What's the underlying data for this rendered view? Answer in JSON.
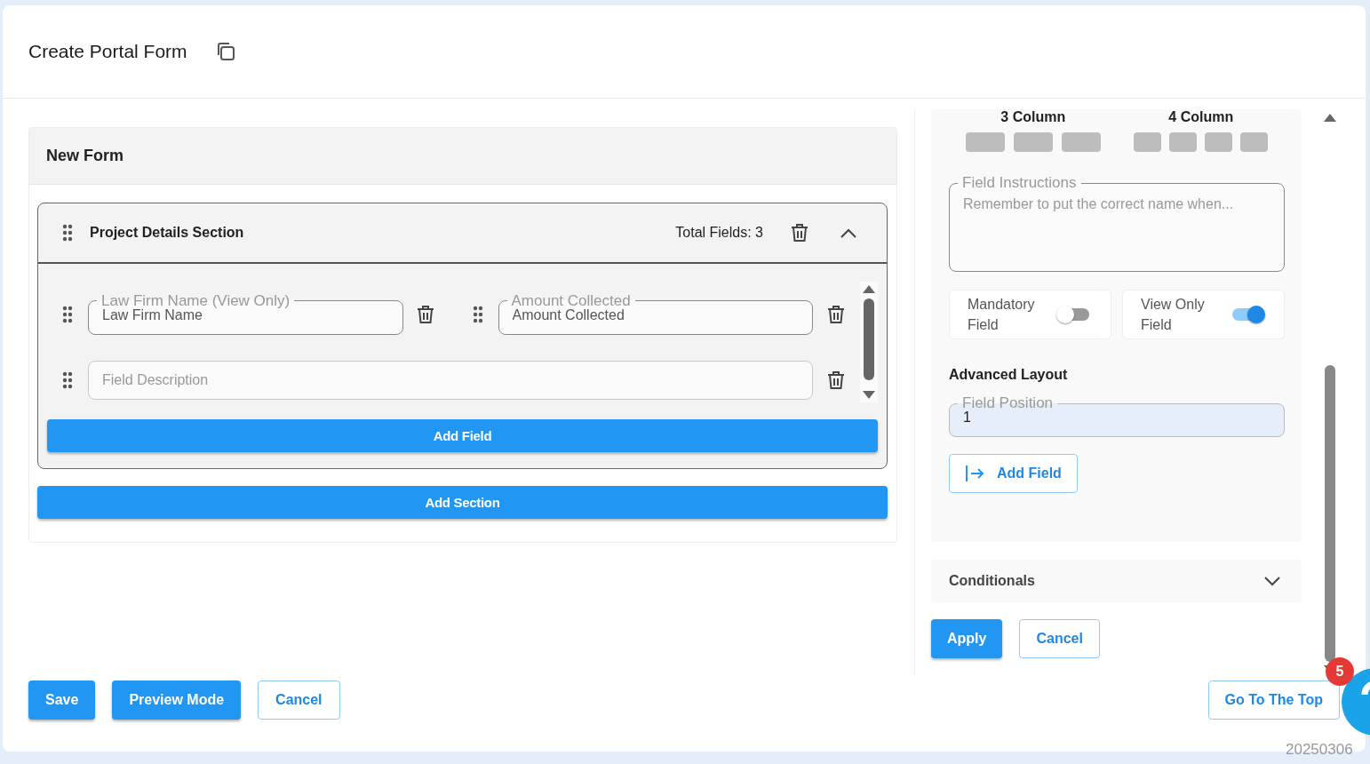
{
  "header": {
    "title": "Create Portal Form"
  },
  "form": {
    "title": "New Form",
    "sections": [
      {
        "title": "Project Details Section",
        "total": "Total Fields: 3",
        "expanded": true,
        "add_field": "Add Field",
        "fields": [
          {
            "kind": "half",
            "label": "Law Firm Name (View Only)",
            "value": "Law Firm Name"
          },
          {
            "kind": "half",
            "label": "Amount Collected",
            "value": "Amount Collected"
          },
          {
            "kind": "full",
            "placeholder": "Field Description"
          }
        ]
      }
    ],
    "add_section": "Add Section"
  },
  "panel": {
    "layouts": [
      {
        "label": "3 Column",
        "kind": "three"
      },
      {
        "label": "4 Column",
        "kind": "four"
      }
    ],
    "instructions": {
      "label": "Field Instructions",
      "placeholder": "Remember to put the correct name when..."
    },
    "toggles": [
      {
        "label": "Mandatory Field",
        "on": false
      },
      {
        "label": "View Only Field",
        "on": true
      }
    ],
    "advanced_title": "Advanced Layout",
    "position": {
      "label": "Field Position",
      "value": "1"
    },
    "add_field": "Add Field",
    "conditionals": {
      "title": "Conditionals",
      "expanded": false
    },
    "actions": [
      {
        "label": "Apply",
        "kind": "primary"
      },
      {
        "label": "Cancel",
        "kind": "outline"
      }
    ]
  },
  "footer": {
    "buttons": [
      {
        "label": "Save",
        "kind": "primary"
      },
      {
        "label": "Preview Mode",
        "kind": "primary"
      },
      {
        "label": "Cancel",
        "kind": "outline"
      }
    ],
    "go_top": "Go To The Top",
    "help_badge": "5",
    "build": "20250306"
  }
}
